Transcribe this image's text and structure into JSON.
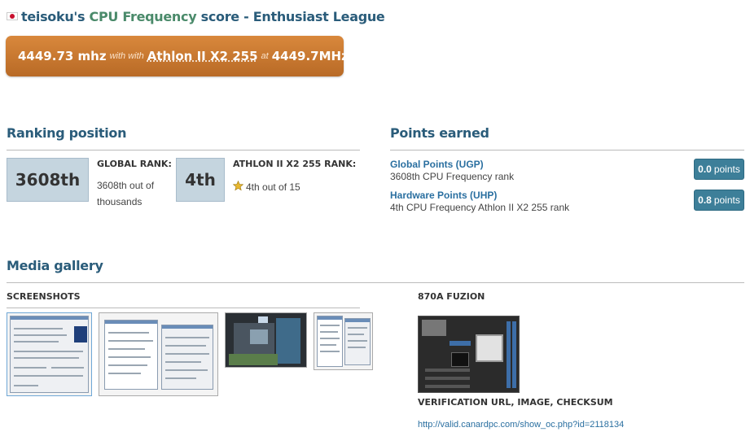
{
  "header": {
    "user": "teisoku's",
    "category": "CPU Frequency",
    "score_word": "score",
    "league": "- Enthusiast League"
  },
  "score": {
    "value": "4449.73 mhz",
    "with_text": "with with",
    "cpu": "Athlon II X2 255",
    "at_text": "at",
    "clock": "4449.7MHz"
  },
  "ranking": {
    "heading": "Ranking position",
    "global_rank": "3608th",
    "global_label": "GLOBAL RANK:",
    "global_desc_1": "3608th out of",
    "global_desc_2": "thousands",
    "hw_rank": "4th",
    "hw_label": "ATHLON II X2 255 RANK:",
    "hw_desc": "4th out of 15"
  },
  "points": {
    "heading": "Points earned",
    "items": [
      {
        "title": "Global Points (UGP)",
        "desc": "3608th CPU Frequency rank",
        "value": "0.0",
        "unit": "points"
      },
      {
        "title": "Hardware Points (UHP)",
        "desc": "4th CPU Frequency Athlon II X2 255 rank",
        "value": "0.8",
        "unit": "points"
      }
    ]
  },
  "gallery": {
    "heading": "Media gallery",
    "screenshots_label": "SCREENSHOTS",
    "board_label": "870A FUZION",
    "verify_label": "VERIFICATION URL, IMAGE, CHECKSUM",
    "verify_url": "http://valid.canardpc.com/show_oc.php?id=2118134"
  },
  "colors": {
    "heading": "#2a5c7a",
    "banner": "#c97a30",
    "rank_box": "#c5d5df",
    "badge": "#3d7f99",
    "link": "#2a6fa0"
  }
}
